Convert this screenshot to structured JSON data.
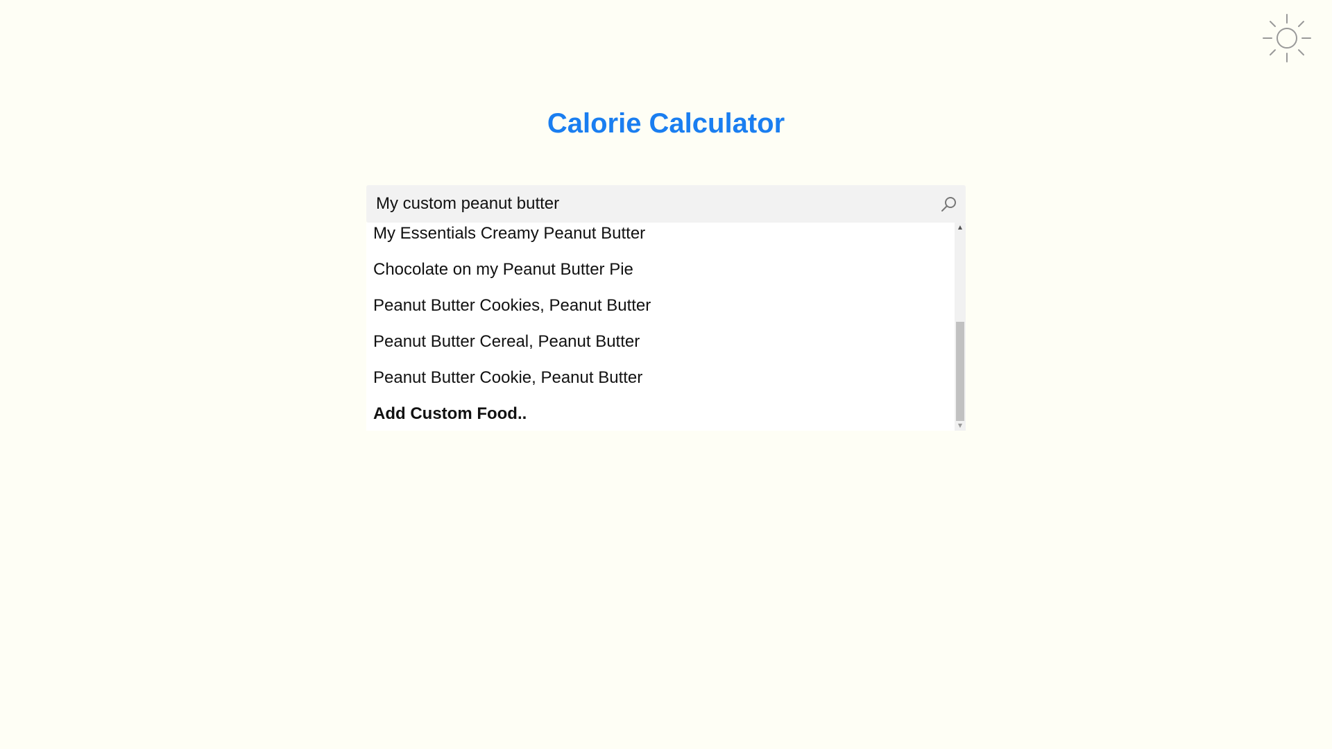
{
  "header": {
    "title": "Calorie Calculator",
    "theme_toggle_icon": "sun-icon"
  },
  "search": {
    "value": "My custom peanut butter",
    "icon": "search-icon"
  },
  "suggestions": [
    {
      "label": "My Essentials Creamy Peanut Butter"
    },
    {
      "label": "Chocolate on my Peanut Butter Pie"
    },
    {
      "label": "Peanut Butter Cookies, Peanut Butter"
    },
    {
      "label": "Peanut Butter Cereal, Peanut Butter"
    },
    {
      "label": "Peanut Butter Cookie, Peanut Butter"
    },
    {
      "label": "Add Custom Food.."
    }
  ],
  "colors": {
    "background": "#fefef5",
    "accent": "#1a7ef0"
  }
}
